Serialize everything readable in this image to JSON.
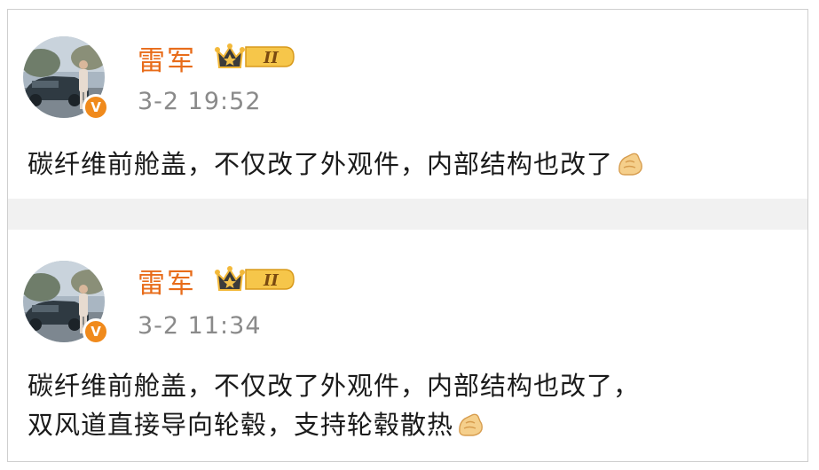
{
  "posts": [
    {
      "author": "雷军",
      "badge_text": "II",
      "verified_mark": "V",
      "timestamp": "3-2 19:52",
      "content_lines": [
        "碳纤维前舱盖，不仅改了外观件，内部结构也改了"
      ],
      "emoji": "pinching-hand-emoji"
    },
    {
      "author": "雷军",
      "badge_text": "II",
      "verified_mark": "V",
      "timestamp": "3-2 11:34",
      "content_lines": [
        "碳纤维前舱盖，不仅改了外观件，内部结构也改了，",
        "双风道直接导向轮毂，支持轮毂散热"
      ],
      "emoji": "pinching-hand-emoji"
    }
  ],
  "colors": {
    "author": "#e86c1a",
    "timestamp": "#8a8a8a",
    "text": "#1a1a1a",
    "verified": "#f08a1c",
    "separator": "#f1f1f1"
  }
}
